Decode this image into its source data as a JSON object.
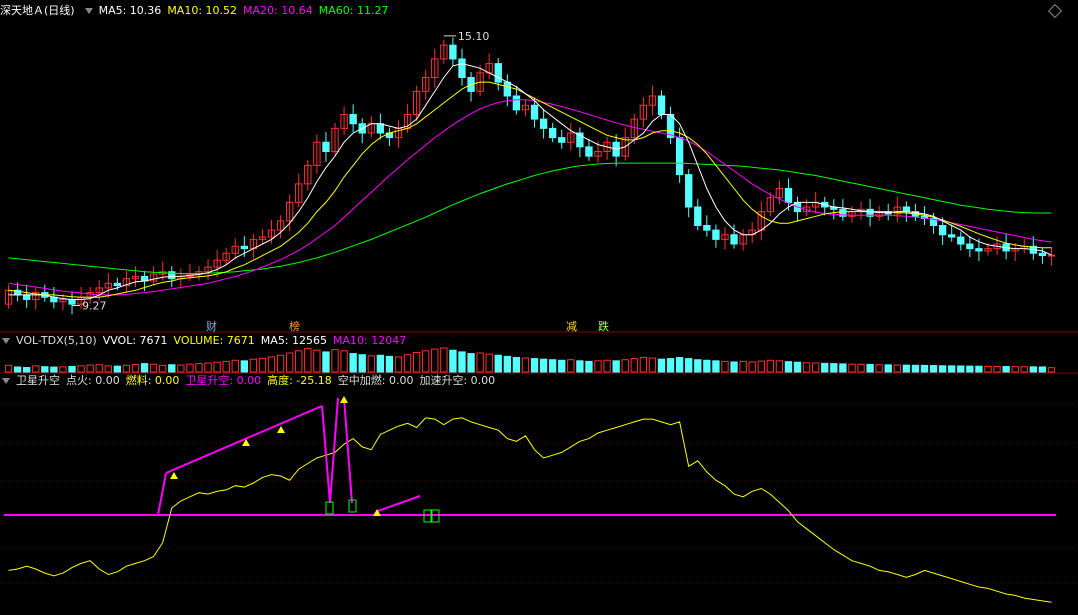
{
  "colors": {
    "bg": "#000000",
    "up": "#ff3030",
    "down": "#54ffff",
    "ma5": "#ffffff",
    "ma10": "#ffff00",
    "ma20": "#ff00ff",
    "ma60": "#00ff00",
    "grid": "#880000"
  },
  "main_header": {
    "title": "深天地Ａ(日线)",
    "ma5": "MA5: 10.36",
    "ma10": "MA10: 10.52",
    "ma20": "MA20: 10.64",
    "ma60": "MA60: 11.27"
  },
  "vol_header": {
    "name": "VOL-TDX(5,10)",
    "vvol": "VVOL: 7671",
    "volume": "VOLUME: 7671",
    "ma5": "MA5: 12565",
    "ma10": "MA10: 12047"
  },
  "ind_header": {
    "name": "卫星升空",
    "dianhuo": "点火: 0.00",
    "ranliao": "燃料: 0.00",
    "weixing": "卫星升空: 0.00",
    "gaodu": "高度: -25.18",
    "kongzhong": "空中加燃: 0.00",
    "jiasu": "加速升空: 0.00"
  },
  "events": [
    {
      "label": "财",
      "color": "#6fb4ff"
    },
    {
      "label": "榜",
      "color": "#ff9a2e"
    },
    {
      "label": "减",
      "color": "#ffd23a"
    },
    {
      "label": "跌",
      "color": "#a0ff60"
    }
  ],
  "chart_data": [
    {
      "type": "candlestick",
      "title": "深天地Ａ(日线)",
      "annotations": [
        {
          "label": "15.10",
          "value": 15.1
        },
        {
          "label": "9.27",
          "value": 9.27
        }
      ],
      "ylim": [
        9.0,
        15.4
      ],
      "closes": [
        9.6,
        9.5,
        9.4,
        9.55,
        9.45,
        9.35,
        9.4,
        9.3,
        9.45,
        9.55,
        9.65,
        9.75,
        9.7,
        9.85,
        9.9,
        9.8,
        9.95,
        10.0,
        9.85,
        9.9,
        9.95,
        10.0,
        10.1,
        10.25,
        10.4,
        10.55,
        10.5,
        10.7,
        10.75,
        10.9,
        11.1,
        11.5,
        11.9,
        12.3,
        12.8,
        12.6,
        13.1,
        13.4,
        13.2,
        13.0,
        13.2,
        13.0,
        12.9,
        13.1,
        13.4,
        13.9,
        14.2,
        14.6,
        14.9,
        14.6,
        14.2,
        13.9,
        14.3,
        14.5,
        14.1,
        13.8,
        13.5,
        13.6,
        13.3,
        13.1,
        12.9,
        12.8,
        13.0,
        12.7,
        12.5,
        12.6,
        12.8,
        12.5,
        12.9,
        13.3,
        13.6,
        13.8,
        13.4,
        12.9,
        12.1,
        11.4,
        11.0,
        10.9,
        10.7,
        10.8,
        10.6,
        10.8,
        10.9,
        11.3,
        11.6,
        11.8,
        11.5,
        11.3,
        11.4,
        11.5,
        11.4,
        11.35,
        11.2,
        11.3,
        11.35,
        11.2,
        11.3,
        11.25,
        11.4,
        11.3,
        11.2,
        11.15,
        11.0,
        10.8,
        10.75,
        10.6,
        10.5,
        10.45,
        10.5,
        10.6,
        10.45,
        10.5,
        10.55,
        10.4,
        10.35,
        10.36
      ],
      "opens": [
        9.3,
        9.6,
        9.5,
        9.4,
        9.55,
        9.45,
        9.35,
        9.4,
        9.3,
        9.45,
        9.55,
        9.65,
        9.75,
        9.7,
        9.85,
        9.9,
        9.8,
        9.95,
        10.0,
        9.85,
        9.9,
        9.95,
        10.0,
        10.1,
        10.25,
        10.4,
        10.55,
        10.5,
        10.7,
        10.75,
        10.9,
        11.1,
        11.5,
        11.9,
        12.3,
        12.8,
        12.6,
        13.1,
        13.4,
        13.2,
        13.0,
        13.2,
        13.0,
        12.9,
        13.1,
        13.4,
        13.9,
        14.2,
        14.6,
        14.9,
        14.6,
        14.2,
        13.9,
        14.3,
        14.5,
        14.1,
        13.8,
        13.5,
        13.6,
        13.3,
        13.1,
        12.9,
        12.8,
        13.0,
        12.7,
        12.5,
        12.6,
        12.8,
        12.5,
        12.9,
        13.3,
        13.6,
        13.8,
        13.4,
        12.9,
        12.1,
        11.4,
        11.0,
        10.9,
        10.7,
        10.8,
        10.6,
        10.8,
        10.9,
        11.3,
        11.6,
        11.8,
        11.5,
        11.3,
        11.4,
        11.5,
        11.4,
        11.35,
        11.2,
        11.3,
        11.35,
        11.2,
        11.3,
        11.25,
        11.4,
        11.3,
        11.2,
        11.15,
        11.0,
        10.8,
        10.75,
        10.6,
        10.5,
        10.45,
        10.5,
        10.6,
        10.45,
        10.5,
        10.55,
        10.4,
        10.35
      ],
      "ma5": [
        9.5,
        9.5,
        9.5,
        9.5,
        9.5,
        9.45,
        9.42,
        9.4,
        9.4,
        9.42,
        9.5,
        9.6,
        9.65,
        9.72,
        9.78,
        9.8,
        9.84,
        9.88,
        9.9,
        9.9,
        9.92,
        9.94,
        9.98,
        10.05,
        10.15,
        10.3,
        10.4,
        10.5,
        10.6,
        10.7,
        10.85,
        11.05,
        11.3,
        11.6,
        11.95,
        12.25,
        12.5,
        12.8,
        13.0,
        13.1,
        13.2,
        13.2,
        13.15,
        13.1,
        13.15,
        13.3,
        13.6,
        13.9,
        14.2,
        14.45,
        14.5,
        14.45,
        14.4,
        14.3,
        14.2,
        14.1,
        14.0,
        13.85,
        13.7,
        13.5,
        13.35,
        13.2,
        13.05,
        12.95,
        12.85,
        12.75,
        12.7,
        12.65,
        12.7,
        12.85,
        13.0,
        13.25,
        13.4,
        13.4,
        13.2,
        12.8,
        12.3,
        11.8,
        11.4,
        11.1,
        10.9,
        10.8,
        10.8,
        10.9,
        11.05,
        11.25,
        11.4,
        11.5,
        11.5,
        11.5,
        11.45,
        11.4,
        11.38,
        11.35,
        11.32,
        11.3,
        11.28,
        11.28,
        11.3,
        11.3,
        11.28,
        11.25,
        11.2,
        11.1,
        11.0,
        10.9,
        10.75,
        10.65,
        10.58,
        10.55,
        10.52,
        10.5,
        10.5,
        10.48,
        10.45,
        10.36
      ],
      "ma10": [
        9.6,
        9.58,
        9.55,
        9.52,
        9.5,
        9.5,
        9.48,
        9.46,
        9.45,
        9.45,
        9.45,
        9.48,
        9.52,
        9.56,
        9.6,
        9.66,
        9.72,
        9.77,
        9.8,
        9.85,
        9.87,
        9.89,
        9.91,
        9.95,
        10.0,
        10.08,
        10.15,
        10.25,
        10.35,
        10.45,
        10.55,
        10.7,
        10.85,
        11.05,
        11.3,
        11.5,
        11.75,
        12.05,
        12.3,
        12.55,
        12.75,
        12.9,
        13.0,
        13.05,
        13.1,
        13.2,
        13.35,
        13.5,
        13.65,
        13.8,
        13.95,
        14.05,
        14.1,
        14.1,
        14.05,
        14.0,
        13.95,
        13.85,
        13.75,
        13.65,
        13.55,
        13.45,
        13.35,
        13.25,
        13.15,
        13.05,
        12.95,
        12.9,
        12.85,
        12.85,
        12.9,
        13.0,
        13.05,
        13.05,
        13.0,
        12.9,
        12.75,
        12.55,
        12.3,
        12.05,
        11.8,
        11.55,
        11.35,
        11.2,
        11.1,
        11.05,
        11.05,
        11.1,
        11.15,
        11.2,
        11.25,
        11.28,
        11.3,
        11.3,
        11.3,
        11.3,
        11.3,
        11.3,
        11.28,
        11.27,
        11.25,
        11.22,
        11.18,
        11.12,
        11.05,
        10.98,
        10.9,
        10.82,
        10.75,
        10.68,
        10.62,
        10.58,
        10.55,
        10.53,
        10.52,
        10.52
      ],
      "ma20": [
        9.75,
        9.72,
        9.7,
        9.67,
        9.64,
        9.61,
        9.58,
        9.56,
        9.54,
        9.52,
        9.5,
        9.5,
        9.5,
        9.51,
        9.53,
        9.55,
        9.57,
        9.6,
        9.63,
        9.66,
        9.69,
        9.72,
        9.75,
        9.8,
        9.85,
        9.9,
        9.96,
        10.02,
        10.1,
        10.18,
        10.26,
        10.36,
        10.46,
        10.58,
        10.72,
        10.86,
        11.0,
        11.18,
        11.36,
        11.54,
        11.72,
        11.9,
        12.08,
        12.25,
        12.42,
        12.58,
        12.74,
        12.9,
        13.04,
        13.18,
        13.3,
        13.42,
        13.52,
        13.6,
        13.66,
        13.7,
        13.72,
        13.72,
        13.7,
        13.66,
        13.62,
        13.57,
        13.52,
        13.46,
        13.4,
        13.34,
        13.28,
        13.22,
        13.17,
        13.12,
        13.08,
        13.04,
        13.0,
        12.96,
        12.9,
        12.82,
        12.72,
        12.6,
        12.46,
        12.32,
        12.18,
        12.04,
        11.9,
        11.78,
        11.67,
        11.57,
        11.48,
        11.4,
        11.34,
        11.29,
        11.26,
        11.24,
        11.23,
        11.22,
        11.22,
        11.22,
        11.22,
        11.22,
        11.21,
        11.2,
        11.18,
        11.16,
        11.13,
        11.1,
        11.06,
        11.02,
        10.98,
        10.94,
        10.9,
        10.86,
        10.82,
        10.78,
        10.74,
        10.7,
        10.67,
        10.64
      ],
      "ma60": [
        10.3,
        10.28,
        10.26,
        10.24,
        10.22,
        10.2,
        10.18,
        10.16,
        10.14,
        10.12,
        10.1,
        10.08,
        10.06,
        10.04,
        10.02,
        10.0,
        9.99,
        9.98,
        9.97,
        9.96,
        9.96,
        9.96,
        9.97,
        9.98,
        9.99,
        10.0,
        10.02,
        10.04,
        10.06,
        10.09,
        10.12,
        10.16,
        10.2,
        10.25,
        10.3,
        10.36,
        10.42,
        10.49,
        10.56,
        10.63,
        10.7,
        10.78,
        10.86,
        10.94,
        11.02,
        11.1,
        11.18,
        11.27,
        11.36,
        11.45,
        11.53,
        11.61,
        11.69,
        11.76,
        11.83,
        11.9,
        11.96,
        12.02,
        12.08,
        12.13,
        12.18,
        12.22,
        12.26,
        12.29,
        12.31,
        12.33,
        12.34,
        12.35,
        12.35,
        12.35,
        12.35,
        12.35,
        12.35,
        12.35,
        12.35,
        12.34,
        12.33,
        12.32,
        12.31,
        12.3,
        12.29,
        12.28,
        12.26,
        12.24,
        12.22,
        12.2,
        12.17,
        12.14,
        12.11,
        12.08,
        12.04,
        12.0,
        11.96,
        11.92,
        11.88,
        11.84,
        11.8,
        11.76,
        11.72,
        11.68,
        11.64,
        11.6,
        11.56,
        11.52,
        11.48,
        11.44,
        11.41,
        11.38,
        11.35,
        11.33,
        11.31,
        11.29,
        11.28,
        11.27,
        11.27,
        11.27
      ]
    },
    {
      "type": "bar",
      "title": "VOL-TDX(5,10)",
      "values": [
        12000,
        9000,
        8000,
        11000,
        9500,
        8800,
        9200,
        10000,
        11000,
        12500,
        13000,
        11000,
        10500,
        12000,
        13500,
        15000,
        14000,
        12000,
        13000,
        12500,
        14000,
        15000,
        16000,
        17500,
        19000,
        21000,
        20000,
        23000,
        24500,
        27000,
        30000,
        34000,
        38000,
        42000,
        39000,
        36000,
        40000,
        38000,
        33000,
        31000,
        29000,
        30000,
        28000,
        27000,
        31000,
        35000,
        38000,
        41000,
        43000,
        39000,
        36000,
        33000,
        34000,
        32000,
        30000,
        28000,
        26000,
        25000,
        24000,
        23000,
        22000,
        21000,
        22000,
        20000,
        19000,
        20000,
        21000,
        20000,
        22000,
        24000,
        26000,
        25000,
        23000,
        24000,
        26000,
        24000,
        22000,
        21000,
        20000,
        19000,
        18000,
        19000,
        18000,
        19500,
        21000,
        20000,
        18500,
        17500,
        16500,
        16000,
        15500,
        15000,
        14500,
        14000,
        13800,
        13500,
        13000,
        12800,
        12500,
        12300,
        12000,
        11800,
        11500,
        11200,
        11000,
        10800,
        10500,
        10300,
        10100,
        9900,
        9800,
        9600,
        9400,
        9200,
        9000,
        7671
      ]
    },
    {
      "type": "line",
      "title": "卫星升空",
      "x_count": 116,
      "gaodu": [
        -25,
        -24,
        -22,
        -24,
        -27,
        -29,
        -27,
        -23,
        -20,
        -18,
        -24,
        -28,
        -26,
        -22,
        -20,
        -18,
        -15,
        -5,
        20,
        25,
        28,
        31,
        30,
        32,
        33,
        36,
        35,
        38,
        42,
        44,
        43,
        40,
        48,
        52,
        56,
        58,
        60,
        66,
        70,
        64,
        62,
        73,
        76,
        79,
        81,
        78,
        85,
        84,
        80,
        84,
        85,
        82,
        80,
        78,
        76,
        70,
        68,
        72,
        62,
        56,
        58,
        60,
        64,
        68,
        70,
        74,
        76,
        78,
        80,
        82,
        84,
        84,
        82,
        80,
        82,
        50,
        54,
        46,
        40,
        36,
        30,
        28,
        32,
        34,
        30,
        24,
        18,
        10,
        5,
        0,
        -5,
        -10,
        -14,
        -18,
        -20,
        -22,
        -25,
        -26,
        -28,
        -30,
        -28,
        -25,
        -27,
        -29,
        -31,
        -33,
        -35,
        -37,
        -38,
        -40,
        -42,
        -43,
        -45,
        -46,
        -47,
        -48
      ],
      "ylim": [
        -55,
        105
      ]
    }
  ]
}
